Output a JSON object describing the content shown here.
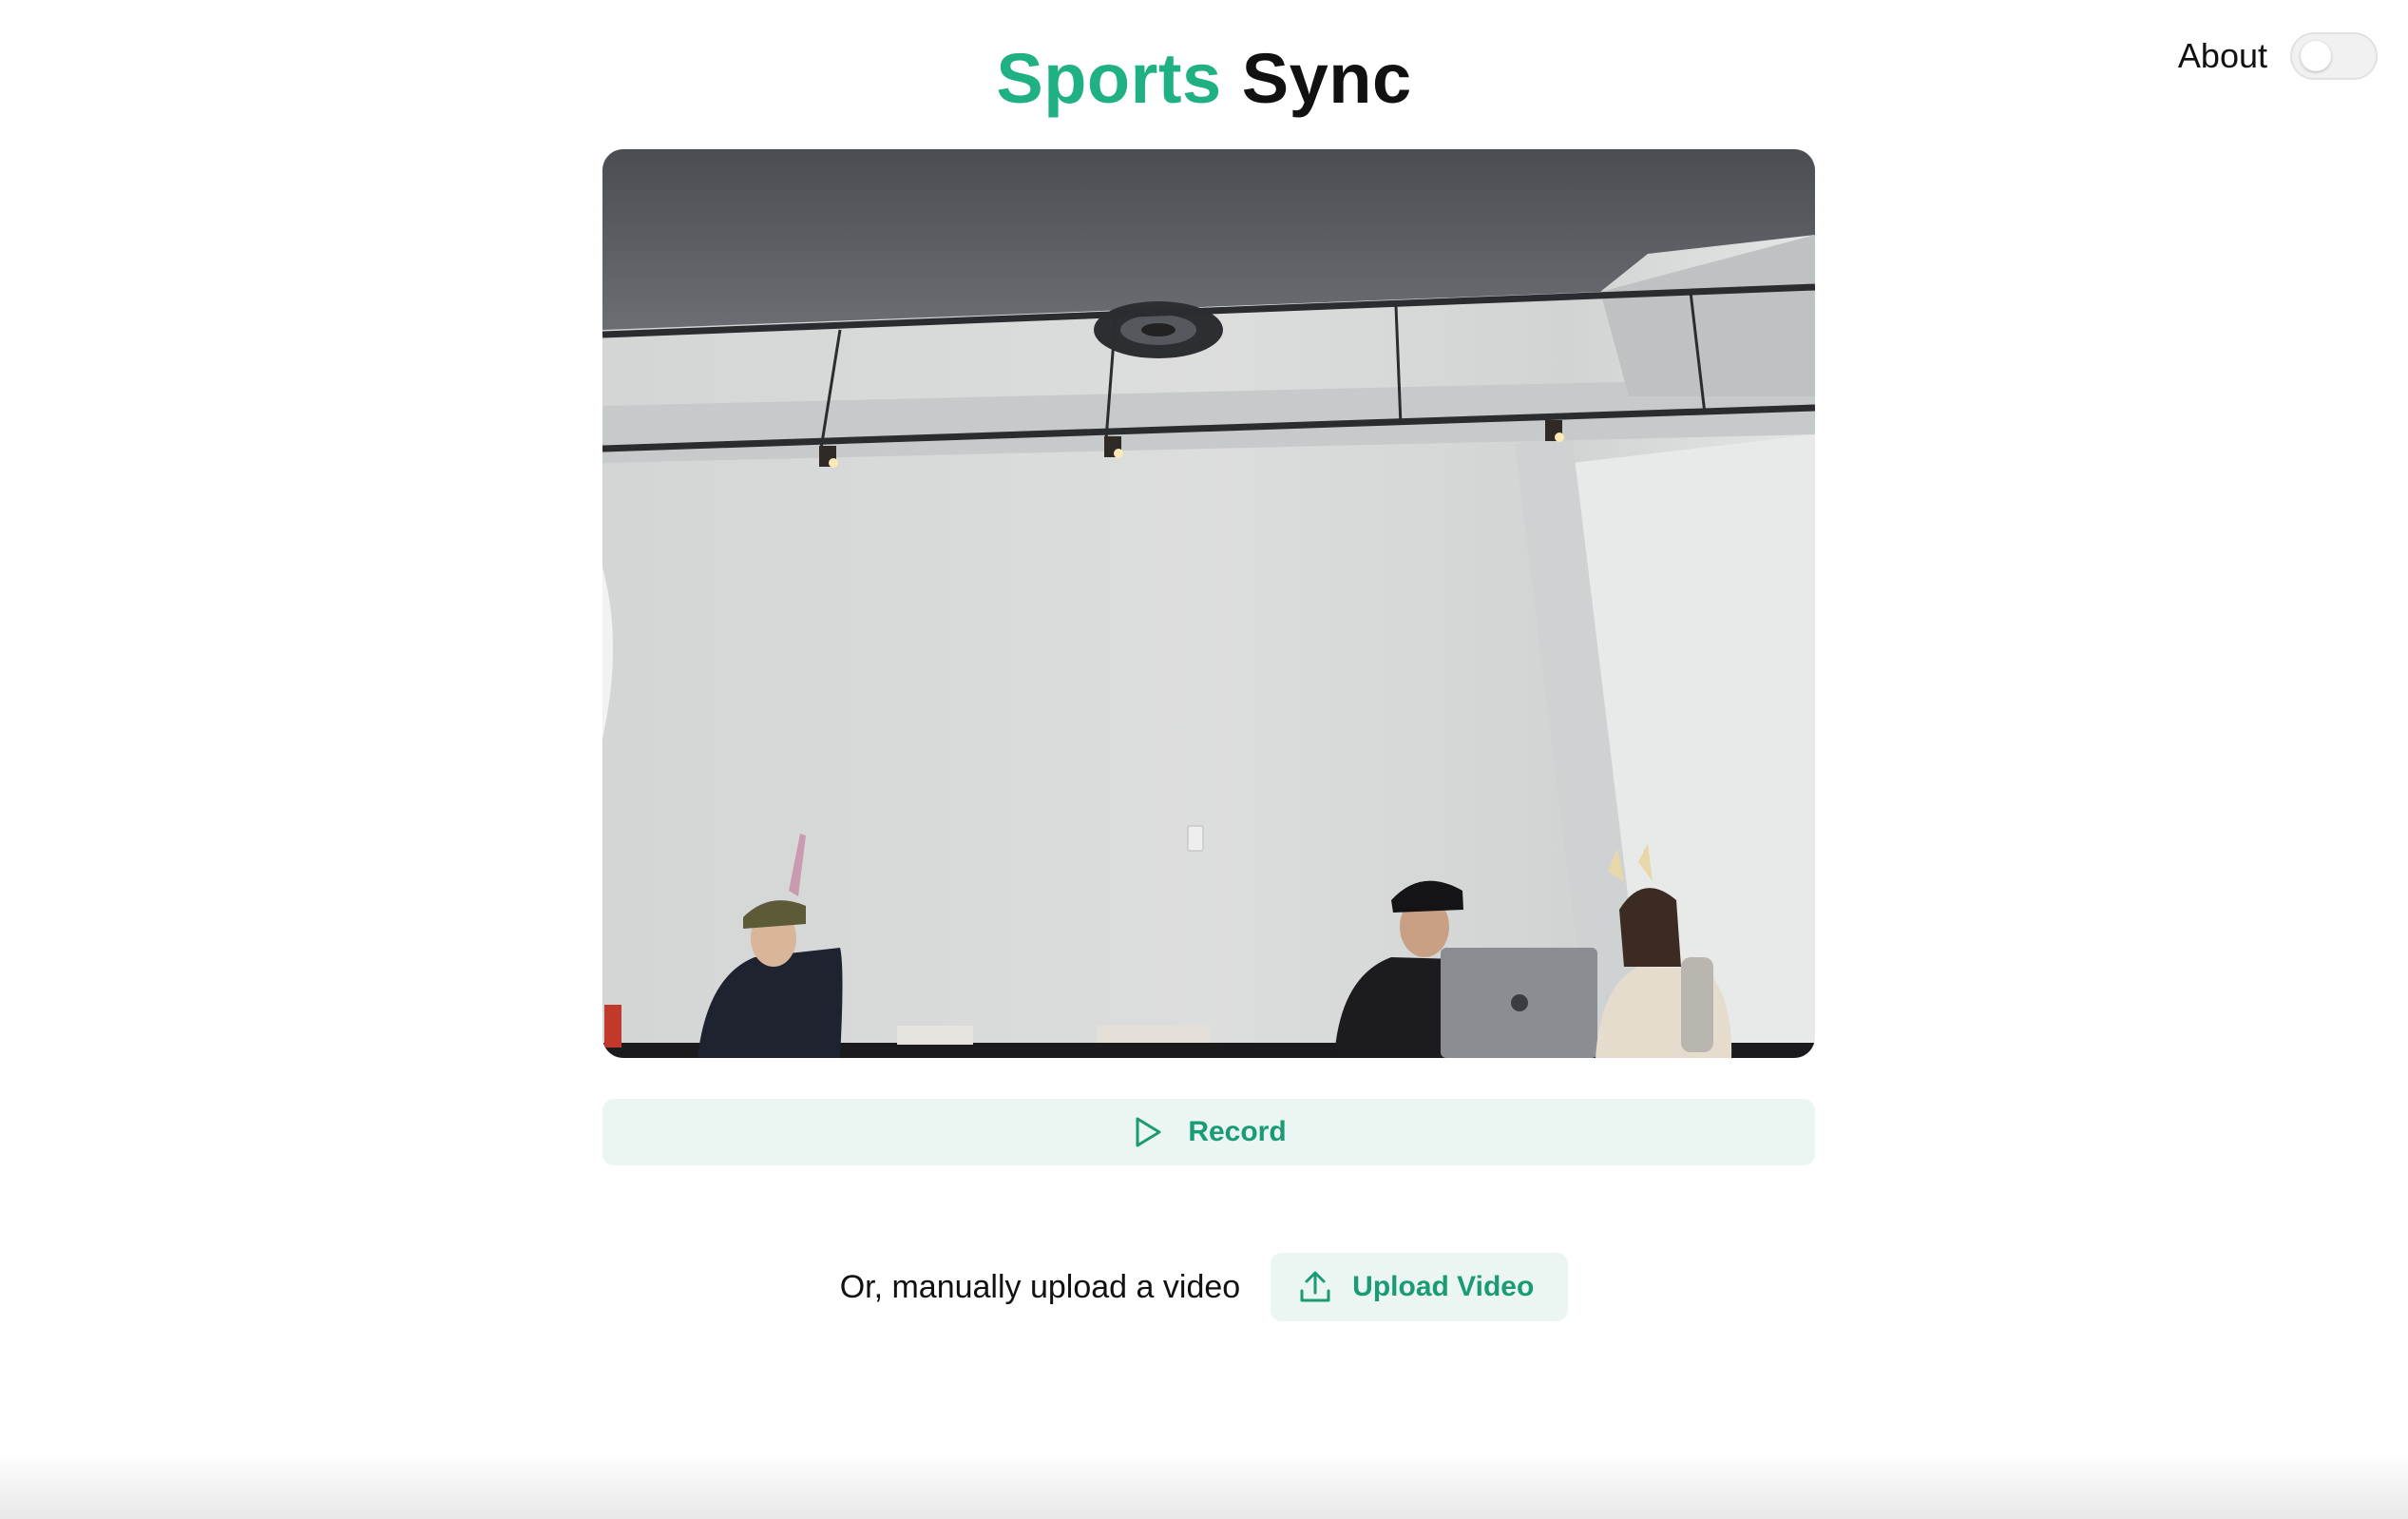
{
  "header": {
    "title_accent": "Sports",
    "title_rest": "Sync",
    "about_label": "About",
    "about_toggle_on": false
  },
  "video": {
    "content": "webcam-live-feed"
  },
  "record": {
    "label": "Record",
    "icon": "play-icon"
  },
  "upload": {
    "prompt": "Or, manually upload a video",
    "button_label": "Upload Video",
    "icon": "upload-icon"
  },
  "colors": {
    "accent": "#1fb083",
    "button_bg": "#ebf5f1",
    "button_text": "#1a9b74"
  }
}
